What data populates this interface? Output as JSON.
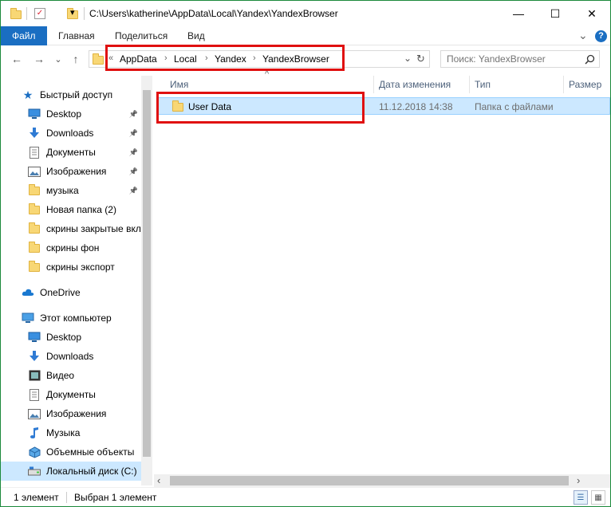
{
  "window": {
    "title": "C:\\Users\\katherine\\AppData\\Local\\Yandex\\YandexBrowser",
    "minimize": "—",
    "maximize": "☐",
    "close": "✕"
  },
  "ribbon": {
    "tabs": [
      "Файл",
      "Главная",
      "Поделиться",
      "Вид"
    ],
    "expand": "⌄",
    "help": "?"
  },
  "navigation": {
    "back": "←",
    "forward": "→",
    "recent": "⌄",
    "up": "↑",
    "overflow": "«",
    "breadcrumbs": [
      "AppData",
      "Local",
      "Yandex",
      "YandexBrowser"
    ],
    "separator": "›",
    "dropdown": "⌄",
    "refresh": "↻",
    "search_placeholder": "Поиск: YandexBrowser"
  },
  "sidebar": {
    "quick_access": "Быстрый доступ",
    "quick_items": [
      {
        "label": "Desktop",
        "icon": "desktop-icon",
        "pinned": true
      },
      {
        "label": "Downloads",
        "icon": "download-icon",
        "pinned": true
      },
      {
        "label": "Документы",
        "icon": "document-icon",
        "pinned": true
      },
      {
        "label": "Изображения",
        "icon": "pictures-icon",
        "pinned": true
      },
      {
        "label": "музыка",
        "icon": "folder-icon",
        "pinned": true
      },
      {
        "label": "Новая папка (2)",
        "icon": "folder-icon",
        "pinned": false
      },
      {
        "label": "скрины закрытые вкл",
        "icon": "folder-icon",
        "pinned": false
      },
      {
        "label": "скрины фон",
        "icon": "folder-icon",
        "pinned": false
      },
      {
        "label": "скрины экспорт",
        "icon": "folder-icon",
        "pinned": false
      }
    ],
    "onedrive": "OneDrive",
    "this_pc": "Этот компьютер",
    "pc_items": [
      {
        "label": "Desktop",
        "icon": "desktop-icon"
      },
      {
        "label": "Downloads",
        "icon": "download-icon"
      },
      {
        "label": "Видео",
        "icon": "video-icon"
      },
      {
        "label": "Документы",
        "icon": "document-icon"
      },
      {
        "label": "Изображения",
        "icon": "pictures-icon"
      },
      {
        "label": "Музыка",
        "icon": "music-icon"
      },
      {
        "label": "Объемные объекты",
        "icon": "3d-objects-icon"
      },
      {
        "label": "Локальный диск (C:)",
        "icon": "drive-icon"
      }
    ]
  },
  "columns": {
    "name": "Имя",
    "date": "Дата изменения",
    "type": "Тип",
    "size": "Размер",
    "sort_arrow": "^"
  },
  "files": [
    {
      "name": "User Data",
      "date": "11.12.2018 14:38",
      "type": "Папка с файлами",
      "size": ""
    }
  ],
  "scroll": {
    "left": "‹",
    "right": "›"
  },
  "status": {
    "count": "1 элемент",
    "selected": "Выбран 1 элемент",
    "details_view": "☰",
    "tiles_view": "▦"
  },
  "colors": {
    "accent": "#1a6ec2",
    "highlight": "#e01010",
    "selection": "#cce8ff"
  }
}
